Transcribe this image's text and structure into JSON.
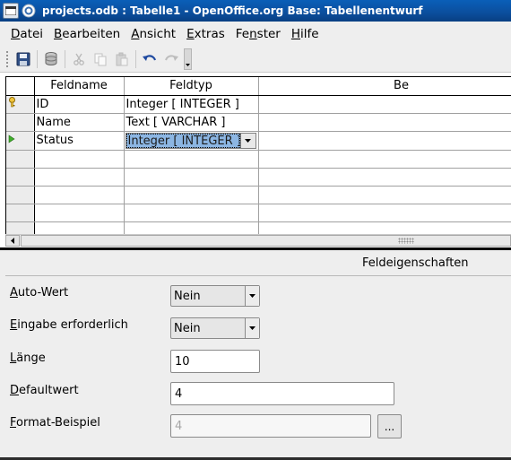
{
  "window": {
    "title": "projects.odb : Tabelle1 - OpenOffice.org Base: Tabellenentwurf"
  },
  "menu": [
    {
      "label": "Datei",
      "accel": "D",
      "rest": "atei"
    },
    {
      "label": "Bearbeiten",
      "accel": "B",
      "rest": "earbeiten"
    },
    {
      "label": "Ansicht",
      "accel": "A",
      "rest": "nsicht"
    },
    {
      "label": "Extras",
      "accel": "E",
      "rest": "xtras"
    },
    {
      "label": "Fenster",
      "accel": "n",
      "pre": "Fe",
      "rest": "ster"
    },
    {
      "label": "Hilfe",
      "accel": "H",
      "rest": "ilfe"
    }
  ],
  "toolbar": {
    "icons": [
      "save-icon",
      "database-icon",
      "cut-icon",
      "copy-icon",
      "paste-icon",
      "undo-icon",
      "redo-icon"
    ]
  },
  "grid": {
    "headers": [
      "Feldname",
      "Feldtyp",
      "Be"
    ],
    "rows": [
      {
        "marker": "primary-key",
        "name": "ID",
        "type": "Integer [ INTEGER ]"
      },
      {
        "marker": "none",
        "name": "Name",
        "type": "Text [ VARCHAR ]"
      },
      {
        "marker": "current-row",
        "name": "Status",
        "type": "Integer [ INTEGER ]"
      }
    ],
    "empty_rows": 5
  },
  "properties": {
    "title": "Feldeigenschaften",
    "auto_value": {
      "label_accel": "A",
      "label_rest": "uto-Wert",
      "value": "Nein"
    },
    "required": {
      "label_accel": "E",
      "label_rest": "ingabe erforderlich",
      "value": "Nein"
    },
    "length": {
      "label_accel": "L",
      "label_rest": "änge",
      "value": "10"
    },
    "default": {
      "label_accel": "D",
      "label_rest": "efaultwert",
      "value": "4"
    },
    "format": {
      "label_accel": "F",
      "label_rest": "ormat-Beispiel",
      "value": "4",
      "button": "..."
    }
  },
  "colors": {
    "titlebar": "#0b4e9d",
    "selection": "#8cb6e3",
    "panel": "#eeeeee"
  }
}
